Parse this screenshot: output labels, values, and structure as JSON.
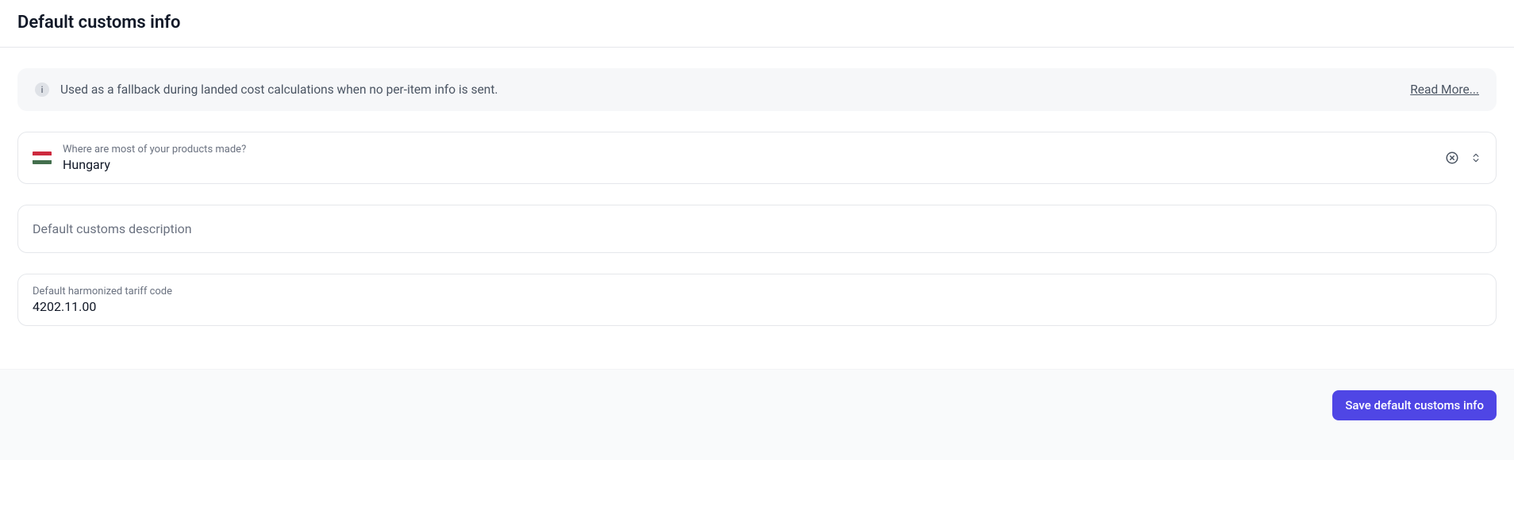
{
  "header": {
    "title": "Default customs info"
  },
  "info_banner": {
    "text": "Used as a fallback during landed cost calculations when no per-item info is sent.",
    "read_more": "Read More..."
  },
  "country_field": {
    "label": "Where are most of your products made?",
    "value": "Hungary"
  },
  "description_field": {
    "placeholder": "Default customs description"
  },
  "tariff_field": {
    "label": "Default harmonized tariff code",
    "value": "4202.11.00"
  },
  "footer": {
    "save_label": "Save default customs info"
  }
}
